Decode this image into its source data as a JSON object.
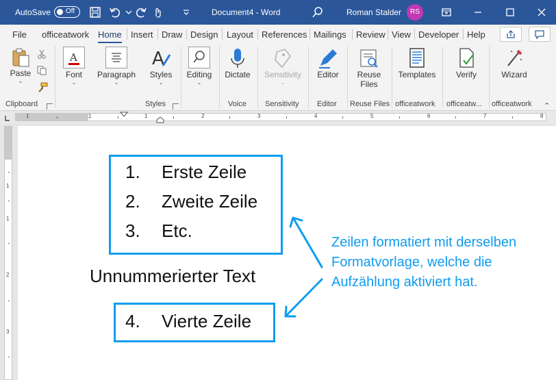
{
  "titlebar": {
    "autosave_label": "AutoSave",
    "autosave_state": "Off",
    "document_title": "Document4 - Word",
    "user_name": "Roman Stalder",
    "user_initials": "RS"
  },
  "menu": {
    "tabs": [
      "File",
      "officeatwork",
      "Home",
      "Insert",
      "Draw",
      "Design",
      "Layout",
      "References",
      "Mailings",
      "Review",
      "View",
      "Developer",
      "Help"
    ],
    "active_tab": "Home"
  },
  "ribbon": {
    "paste": "Paste",
    "font": "Font",
    "paragraph": "Paragraph",
    "styles": "Styles",
    "editing": "Editing",
    "dictate": "Dictate",
    "sensitivity": "Sensitivity",
    "editor": "Editor",
    "reuse_files_1": "Reuse",
    "reuse_files_2": "Files",
    "templates": "Templates",
    "verify": "Verify",
    "wizard": "Wizard",
    "groups": {
      "clipboard": "Clipboard",
      "styles": "Styles",
      "voice": "Voice",
      "sensitivity": "Sensitivity",
      "editor": "Editor",
      "reuse_files": "Reuse Files",
      "officeatwork_1": "officeatwork",
      "officeatwork_2": "officeatw...",
      "officeatwork_3": "officeatwork"
    }
  },
  "ruler": {
    "numbers": [
      "1",
      "1",
      "1",
      "2",
      "3",
      "4",
      "5",
      "6",
      "7",
      "8"
    ],
    "vertical_numbers": [
      "1",
      "1",
      "2",
      "3"
    ]
  },
  "document": {
    "list_top": [
      {
        "num": "1.",
        "text": "Erste Zeile"
      },
      {
        "num": "2.",
        "text": "Zweite Zeile"
      },
      {
        "num": "3.",
        "text": "Etc."
      }
    ],
    "plain_text": "Unnummerierter Text",
    "list_bottom": {
      "num": "4.",
      "text": "Vierte Zeile"
    },
    "annotation": [
      "Zeilen formatiert mit derselben",
      "Formatvorlage, welche die",
      "Aufzählung aktiviert hat."
    ]
  },
  "colors": {
    "title_bar": "#2b579a",
    "annotation_blue": "#0f9cf0",
    "avatar": "#c239b3"
  }
}
